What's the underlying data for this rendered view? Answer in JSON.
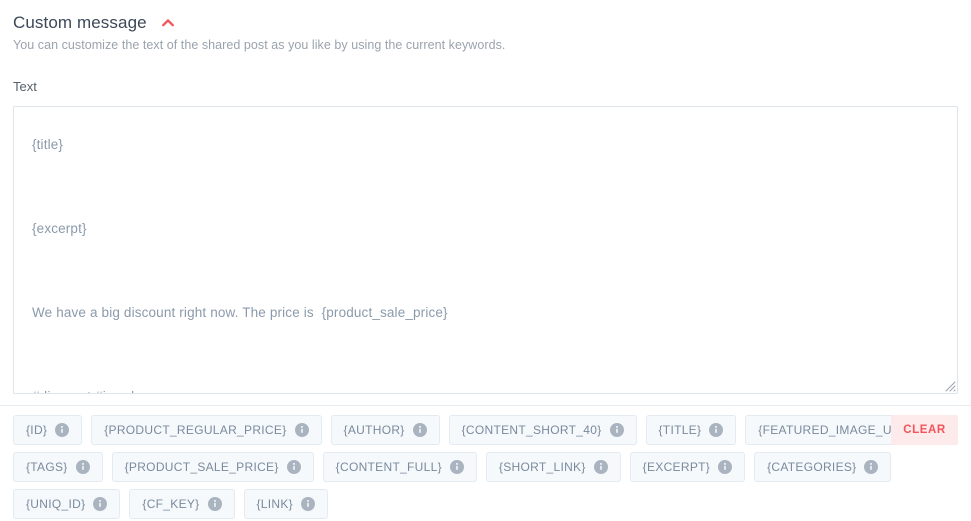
{
  "panel": {
    "title": "Custom message",
    "subtitle": "You can customize the text of the shared post as you like by using the current keywords.",
    "collapse_icon": "chevron-up-icon",
    "accent_color": "#f2545b"
  },
  "field": {
    "label": "Text",
    "value": "{title}\n\n{excerpt}\n\nWe have a big discount right now. The price is  {product_sale_price}\n\n#discount #jewelry",
    "placeholder": ""
  },
  "keywords": {
    "info_icon": "info-icon",
    "rows": [
      [
        {
          "label": "{ID}"
        },
        {
          "label": "{PRODUCT_REGULAR_PRICE}"
        },
        {
          "label": "{AUTHOR}"
        },
        {
          "label": "{CONTENT_SHORT_40}"
        },
        {
          "label": "{TITLE}"
        },
        {
          "label": "{FEATURED_IMAGE_URL}"
        }
      ],
      [
        {
          "label": "{TAGS}"
        },
        {
          "label": "{PRODUCT_SALE_PRICE}"
        },
        {
          "label": "{CONTENT_FULL}"
        },
        {
          "label": "{SHORT_LINK}"
        },
        {
          "label": "{EXCERPT}"
        },
        {
          "label": "{CATEGORIES}"
        }
      ],
      [
        {
          "label": "{UNIQ_ID}"
        },
        {
          "label": "{CF_KEY}"
        },
        {
          "label": "{LINK}"
        }
      ]
    ]
  },
  "actions": {
    "clear_label": "CLEAR"
  }
}
